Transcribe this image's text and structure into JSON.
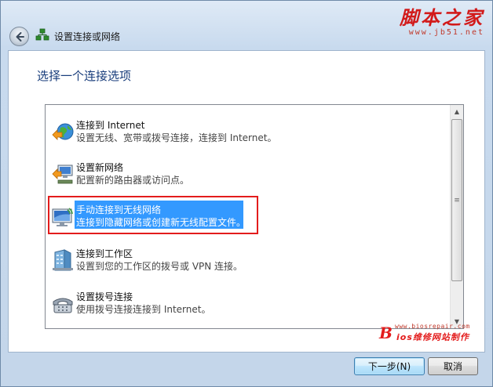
{
  "window": {
    "title": "设置连接或网络"
  },
  "watermark_top": {
    "title": "脚本之家",
    "url": "www.jb51.net"
  },
  "heading": "选择一个连接选项",
  "options": [
    {
      "title": "连接到 Internet",
      "desc": "设置无线、宽带或拨号连接，连接到 Internet。",
      "icon": "globe-connection-icon"
    },
    {
      "title": "设置新网络",
      "desc": "配置新的路由器或访问点。",
      "icon": "new-network-icon"
    },
    {
      "title": "手动连接到无线网络",
      "desc": "连接到隐藏网络或创建新无线配置文件。",
      "icon": "wireless-monitor-icon",
      "selected": true
    },
    {
      "title": "连接到工作区",
      "desc": "设置到您的工作区的拨号或 VPN 连接。",
      "icon": "workplace-building-icon"
    },
    {
      "title": "设置拨号连接",
      "desc": "使用拨号连接连接到 Internet。",
      "icon": "dialup-phone-icon"
    }
  ],
  "watermark_bottom": {
    "logo": "B",
    "url": "www.biosrepair.com",
    "text": "ios维修网站制作"
  },
  "buttons": {
    "next": "下一步(N)",
    "cancel": "取消"
  },
  "colors": {
    "selection": "#3399ff",
    "highlight_frame": "#e31c1c",
    "heading": "#1a3e7c"
  }
}
